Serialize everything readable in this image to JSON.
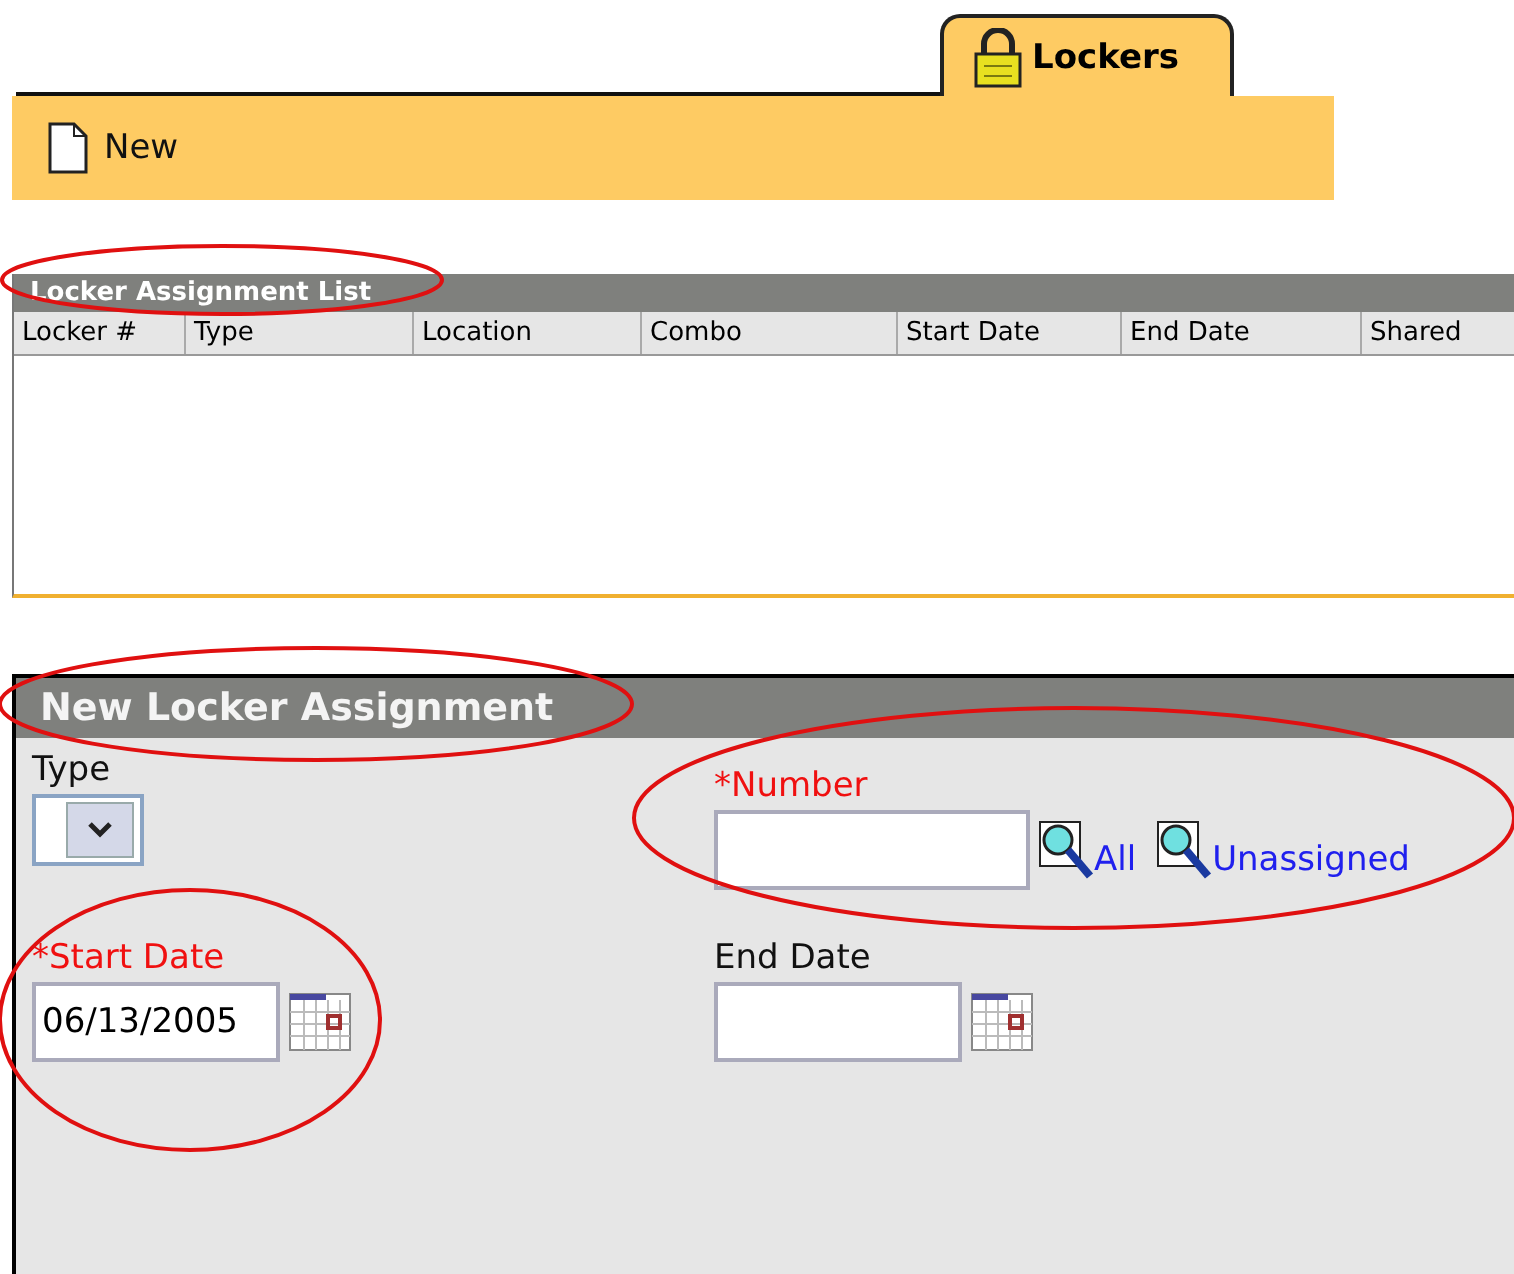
{
  "tab": {
    "label": "Lockers",
    "selected": true
  },
  "toolbar": {
    "new_button": "New"
  },
  "list": {
    "title": "Locker Assignment List",
    "columns": [
      "Locker #",
      "Type",
      "Location",
      "Combo",
      "Start Date",
      "End Date",
      "Shared"
    ]
  },
  "form": {
    "title": "New Locker Assignment",
    "type": {
      "label": "Type",
      "required": false
    },
    "number": {
      "label": "*Number",
      "required": true,
      "links": [
        "All",
        "Unassigned"
      ]
    },
    "start_date": {
      "label": "*Start Date",
      "required": true,
      "value": "06/13/2005"
    },
    "end_date": {
      "label": "End Date",
      "required": false
    }
  }
}
